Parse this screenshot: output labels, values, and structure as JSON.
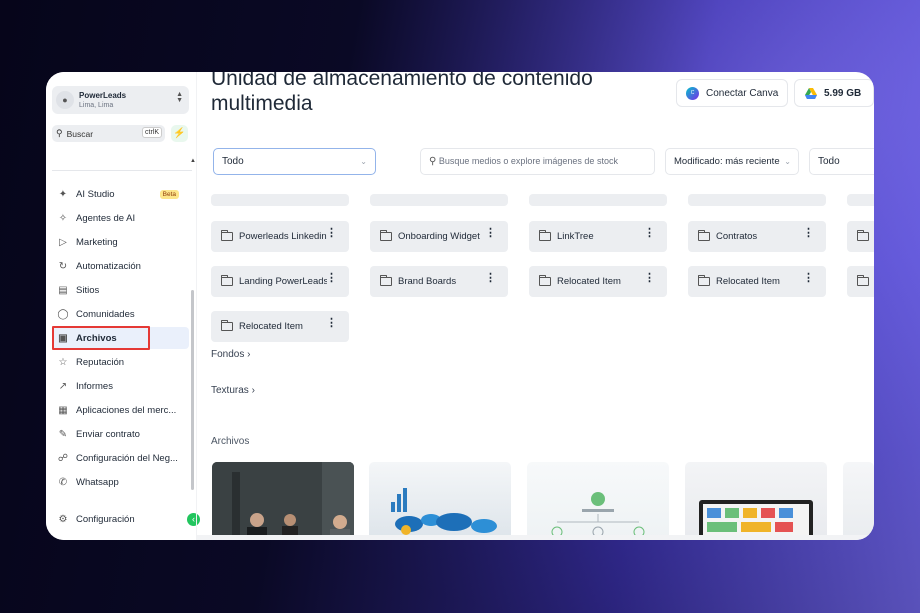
{
  "account": {
    "name": "PowerLeads",
    "location": "Lima, Lima"
  },
  "search": {
    "label": "Buscar",
    "shortcut": "ctrlK"
  },
  "sidebar": {
    "items": [
      {
        "label": "AI Studio",
        "icon": "ai-studio-icon",
        "badge": "Beta"
      },
      {
        "label": "Agentes de AI",
        "icon": "sparkle-icon"
      },
      {
        "label": "Marketing",
        "icon": "megaphone-icon"
      },
      {
        "label": "Automatización",
        "icon": "automation-icon"
      },
      {
        "label": "Sitios",
        "icon": "sites-icon"
      },
      {
        "label": "Comunidades",
        "icon": "community-icon"
      },
      {
        "label": "Archivos",
        "icon": "image-icon",
        "active": true
      },
      {
        "label": "Reputación",
        "icon": "star-icon"
      },
      {
        "label": "Informes",
        "icon": "trend-icon"
      },
      {
        "label": "Aplicaciones del merc...",
        "icon": "apps-grid-icon"
      },
      {
        "label": "Enviar contrato",
        "icon": "contract-icon"
      },
      {
        "label": "Configuración del Neg...",
        "icon": "business-settings-icon"
      },
      {
        "label": "Whatsapp",
        "icon": "whatsapp-icon"
      }
    ],
    "settings": "Configuración"
  },
  "header": {
    "title": "Unidad de almacenamiento de contenido multimedia",
    "canva_button": "Conectar Canva",
    "storage": "5.99 GB"
  },
  "filters": {
    "type": "Todo",
    "search_placeholder": "Busque medios o explore imágenes de stock",
    "sort": "Modificado: más reciente",
    "type2": "Todo"
  },
  "folders": [
    [
      "Powerleads Linkedin",
      "Onboarding Widget",
      "LinkTree",
      "Contratos"
    ],
    [
      "Landing PowerLeads",
      "Brand Boards",
      "Relocated Item",
      "Relocated Item"
    ],
    [
      "Relocated Item"
    ]
  ],
  "sections": {
    "fondos": "Fondos",
    "texturas": "Texturas",
    "archivos": "Archivos"
  },
  "colors": {
    "accent": "#22c55e",
    "highlight": "#e53935",
    "active_bg": "#eaf0fb"
  }
}
